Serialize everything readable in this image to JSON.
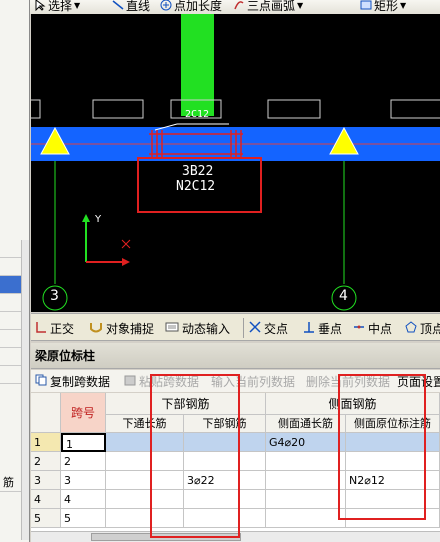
{
  "toolbar": {
    "select": "选择",
    "line": "直线",
    "point_length": "点加长度",
    "arc3": "三点画弧",
    "rect": "矩形"
  },
  "left_panel": {
    "rows": [
      "",
      "",
      "",
      "",
      "",
      "",
      "",
      "",
      "筋"
    ]
  },
  "cad": {
    "beam_label_top": "2C12",
    "annotation_line1": "3B22",
    "annotation_line2": "N2C12",
    "axis_left": "3",
    "axis_right": "4",
    "ucs_y": "Y",
    "colors": {
      "background": "#000000",
      "beam": "#1464ff",
      "column": "#22e022",
      "support": "#ffff00",
      "axis": "#22e022",
      "highlight_box": "#e02020"
    }
  },
  "snapbar": {
    "ortho": "正交",
    "object_snap": "对象捕捉",
    "dynamic_input": "动态输入",
    "intersection": "交点",
    "perpendicular": "垂点",
    "midpoint": "中点",
    "vertex": "顶点"
  },
  "panel": {
    "title": "梁原位标柱",
    "actions": {
      "copy_span": "复制跨数据",
      "paste_span": "粘贴跨数据",
      "input_col": "输入当前列数据",
      "delete_col": "删除当前列数据",
      "page_setup": "页面设置"
    }
  },
  "table": {
    "span_header": "跨号",
    "group_bottom": "下部钢筋",
    "group_side": "侧面钢筋",
    "columns": [
      "下通长筋",
      "下部钢筋",
      "侧面通长筋",
      "侧面原位标注筋"
    ],
    "rows": [
      {
        "num": "1",
        "span": "1",
        "bottom_through": "",
        "bottom": "",
        "side_through": "G4⌀20",
        "side_orig": ""
      },
      {
        "num": "2",
        "span": "2",
        "bottom_through": "",
        "bottom": "",
        "side_through": "",
        "side_orig": ""
      },
      {
        "num": "3",
        "span": "3",
        "bottom_through": "",
        "bottom": "3⌀22",
        "side_through": "",
        "side_orig": "N2⌀12"
      },
      {
        "num": "4",
        "span": "4",
        "bottom_through": "",
        "bottom": "",
        "side_through": "",
        "side_orig": ""
      },
      {
        "num": "5",
        "span": "5",
        "bottom_through": "",
        "bottom": "",
        "side_through": "",
        "side_orig": ""
      }
    ]
  }
}
